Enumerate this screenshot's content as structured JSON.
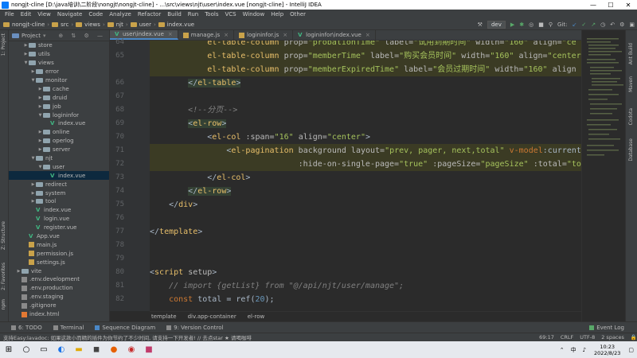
{
  "window": {
    "title": "nongjt-cline [D:\\java培训\\二阶段\\nongjt\\nongjt-cline] - ...\\src\\views\\njt\\user\\index.vue [nongjt-cline] - IntelliJ IDEA",
    "minimize": "—",
    "maximize": "☐",
    "close": "✕"
  },
  "menu": [
    "File",
    "Edit",
    "View",
    "Navigate",
    "Code",
    "Analyze",
    "Refactor",
    "Build",
    "Run",
    "Tools",
    "VCS",
    "Window",
    "Help",
    "Other"
  ],
  "breadcrumbs": [
    "nongjt-cline",
    "src",
    "views",
    "njt",
    "user",
    "index.vue"
  ],
  "run_config": "dev",
  "git_label": "Git:",
  "project_panel": {
    "title": "Project",
    "tree": [
      {
        "label": "store",
        "indent": 2,
        "kind": "folder",
        "arrow": "▶"
      },
      {
        "label": "utils",
        "indent": 2,
        "kind": "folder",
        "arrow": "▶"
      },
      {
        "label": "views",
        "indent": 2,
        "kind": "folder",
        "arrow": "▼"
      },
      {
        "label": "error",
        "indent": 3,
        "kind": "folder",
        "arrow": "▶"
      },
      {
        "label": "monitor",
        "indent": 3,
        "kind": "folder",
        "arrow": "▼"
      },
      {
        "label": "cache",
        "indent": 4,
        "kind": "folder",
        "arrow": "▶"
      },
      {
        "label": "druid",
        "indent": 4,
        "kind": "folder",
        "arrow": "▶"
      },
      {
        "label": "job",
        "indent": 4,
        "kind": "folder",
        "arrow": "▶"
      },
      {
        "label": "logininfor",
        "indent": 4,
        "kind": "folder",
        "arrow": "▼"
      },
      {
        "label": "index.vue",
        "indent": 5,
        "kind": "vue",
        "arrow": ""
      },
      {
        "label": "online",
        "indent": 4,
        "kind": "folder",
        "arrow": "▶"
      },
      {
        "label": "operlog",
        "indent": 4,
        "kind": "folder",
        "arrow": "▶"
      },
      {
        "label": "server",
        "indent": 4,
        "kind": "folder",
        "arrow": "▶"
      },
      {
        "label": "njt",
        "indent": 3,
        "kind": "folder",
        "arrow": "▼"
      },
      {
        "label": "user",
        "indent": 4,
        "kind": "folder",
        "arrow": "▼"
      },
      {
        "label": "index.vue",
        "indent": 5,
        "kind": "vue",
        "arrow": "",
        "selected": true
      },
      {
        "label": "redirect",
        "indent": 3,
        "kind": "folder",
        "arrow": "▶"
      },
      {
        "label": "system",
        "indent": 3,
        "kind": "folder",
        "arrow": "▶"
      },
      {
        "label": "tool",
        "indent": 3,
        "kind": "folder",
        "arrow": "▶"
      },
      {
        "label": "index.vue",
        "indent": 3,
        "kind": "vue",
        "arrow": ""
      },
      {
        "label": "login.vue",
        "indent": 3,
        "kind": "vue",
        "arrow": ""
      },
      {
        "label": "register.vue",
        "indent": 3,
        "kind": "vue",
        "arrow": ""
      },
      {
        "label": "App.vue",
        "indent": 2,
        "kind": "vue",
        "arrow": ""
      },
      {
        "label": "main.js",
        "indent": 2,
        "kind": "js",
        "arrow": ""
      },
      {
        "label": "permission.js",
        "indent": 2,
        "kind": "js",
        "arrow": ""
      },
      {
        "label": "settings.js",
        "indent": 2,
        "kind": "js",
        "arrow": ""
      },
      {
        "label": "vite",
        "indent": 1,
        "kind": "folder",
        "arrow": "▶"
      },
      {
        "label": ".env.development",
        "indent": 1,
        "kind": "env",
        "arrow": ""
      },
      {
        "label": ".env.production",
        "indent": 1,
        "kind": "env",
        "arrow": ""
      },
      {
        "label": ".env.staging",
        "indent": 1,
        "kind": "env",
        "arrow": ""
      },
      {
        "label": ".gitignore",
        "indent": 1,
        "kind": "env",
        "arrow": ""
      },
      {
        "label": "index.html",
        "indent": 1,
        "kind": "html",
        "arrow": ""
      }
    ]
  },
  "left_stripe": [
    "1: Project",
    "Z: Structure",
    "2: Favorites",
    "npm"
  ],
  "right_stripe": [
    "Ant Build",
    "Maven",
    "Codota",
    "Database"
  ],
  "tabs": [
    {
      "label": "user\\index.vue",
      "active": true
    },
    {
      "label": "manage.js",
      "active": false
    },
    {
      "label": "logininfor.js",
      "active": false
    },
    {
      "label": "logininfor\\index.vue",
      "active": false
    }
  ],
  "code_lines": [
    {
      "num": "64",
      "hl": true,
      "html": "            <span class='tagc'>el-table-column</span> <span class='attr'>prop=</span><span class='str'>\"probationTime\"</span> <span class='attr'>label=</span><span class='str'>\"试用到期时间\"</span> <span class='attr'>width=</span><span class='str'>\"160\"</span> <span class='attr'>align=</span><span class='str'>\"ce</span>"
    },
    {
      "num": "65",
      "hl": true,
      "html": "            <span class='tagc'>el-table-column</span> <span class='attr'>prop=</span><span class='str'>\"memberTime\"</span> <span class='attr'>label=</span><span class='str'>\"购买会员时间\"</span> <span class='attr'>width=</span><span class='str'>\"160\"</span> <span class='attr'>align=</span><span class='str'>\"center</span>"
    },
    {
      "num": "",
      "hl": true,
      "html": "            <span class='tagc'>el-table-column</span> <span class='attr'>prop=</span><span class='str'>\"memberExpiredTime\"</span> <span class='attr'>label=</span><span class='str'>\"会员过期时间\"</span> <span class='attr'>width=</span><span class='str'>\"160\"</span> <span class='attr'>align</span>"
    },
    {
      "num": "66",
      "hl": false,
      "html": "        <span class='tagbg'>&lt;/<span class='tagc'>el-table</span>&gt;</span>"
    },
    {
      "num": "67",
      "hl": false,
      "html": ""
    },
    {
      "num": "68",
      "hl": false,
      "html": "        <span class='cmt'>&lt;!--分页--&gt;</span>"
    },
    {
      "num": "69",
      "hl": false,
      "html": "        <span class='tagbg'>&lt;<span class='tagc'>el-row</span>&gt;</span>"
    },
    {
      "num": "70",
      "hl": false,
      "html": "            &lt;<span class='tagc'>el-col</span> <span class='attr'>:span=</span><span class='str'>\"16\"</span> <span class='attr'>align=</span><span class='str'>\"center\"</span>&gt;"
    },
    {
      "num": "71",
      "hl": true,
      "html": "                &lt;<span class='tagc'>el-pagination</span> <span class='attr'>background</span> <span class='attr'>layout=</span><span class='str'>\"prev, pager, next,total\"</span> <span class='kw'>v-model</span>:currentPa"
    },
    {
      "num": "72",
      "hl": true,
      "html": "                               <span class='attr'>:hide-on-single-page=</span><span class='str'>\"true\"</span> <span class='attr'>:pageSize=</span><span class='str'>\"pageSize\"</span> <span class='attr'>:total=</span><span class='str'>\"tota</span>"
    },
    {
      "num": "73",
      "hl": false,
      "html": "            &lt;/<span class='tagc'>el-col</span>&gt;"
    },
    {
      "num": "74",
      "hl": false,
      "html": "        <span class='tagbg'>&lt;/<span class='tagc'>el-row</span>&gt;</span>"
    },
    {
      "num": "75",
      "hl": false,
      "html": "    &lt;/<span class='tagc'>div</span>&gt;"
    },
    {
      "num": "76",
      "hl": false,
      "html": ""
    },
    {
      "num": "77",
      "hl": false,
      "html": "&lt;/<span class='tagc'>template</span>&gt;"
    },
    {
      "num": "78",
      "hl": false,
      "html": ""
    },
    {
      "num": "79",
      "hl": false,
      "html": ""
    },
    {
      "num": "80",
      "hl": false,
      "html": "&lt;<span class='tagc'>script</span> <span class='attr'>setup</span>&gt;"
    },
    {
      "num": "81",
      "hl": false,
      "html": "    <span class='cmt'>// import {getList} from \"@/api/njt/user/manage\";</span>"
    },
    {
      "num": "82",
      "hl": false,
      "html": "    <span class='kw'>const</span> total = ref(<span style='color:#6897bb'>20</span>);"
    }
  ],
  "editor_breadcrumb": [
    "template",
    "div.app-container",
    "el-row"
  ],
  "tool_buttons": [
    "6: TODO",
    "Terminal",
    "Sequence Diagram",
    "9: Version Control"
  ],
  "event_log": "Event Log",
  "status": {
    "message": "支持Easy:lavadoc: 如果这款小而精的插件为你节约了不少时间, 请支持一下开发者! // 去点star ★ 请喝咖啡",
    "position": "69:17",
    "line_sep": "CRLF",
    "encoding": "UTF-8",
    "indent": "2 spaces"
  },
  "taskbar": {
    "time": "10:23",
    "date": "2022/8/23",
    "lang": "中"
  }
}
